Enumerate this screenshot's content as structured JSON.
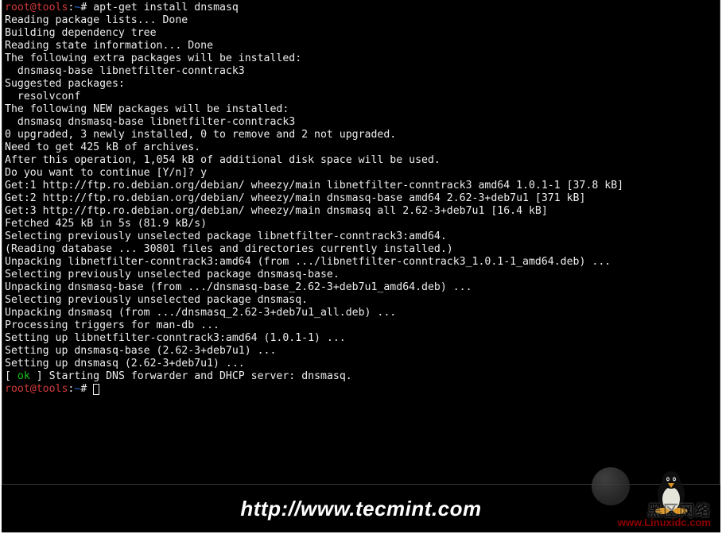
{
  "prompt": {
    "user": "root@tools",
    "sep": ":",
    "path": "~",
    "symbol": "#"
  },
  "command": "apt-get install dnsmasq",
  "lines": [
    "Reading package lists... Done",
    "Building dependency tree",
    "Reading state information... Done",
    "The following extra packages will be installed:",
    "  dnsmasq-base libnetfilter-conntrack3",
    "Suggested packages:",
    "  resolvconf",
    "The following NEW packages will be installed:",
    "  dnsmasq dnsmasq-base libnetfilter-conntrack3",
    "0 upgraded, 3 newly installed, 0 to remove and 2 not upgraded.",
    "Need to get 425 kB of archives.",
    "After this operation, 1,054 kB of additional disk space will be used.",
    "Do you want to continue [Y/n]? y",
    "Get:1 http://ftp.ro.debian.org/debian/ wheezy/main libnetfilter-conntrack3 amd64 1.0.1-1 [37.8 kB]",
    "Get:2 http://ftp.ro.debian.org/debian/ wheezy/main dnsmasq-base amd64 2.62-3+deb7u1 [371 kB]",
    "Get:3 http://ftp.ro.debian.org/debian/ wheezy/main dnsmasq all 2.62-3+deb7u1 [16.4 kB]",
    "Fetched 425 kB in 5s (81.9 kB/s)",
    "Selecting previously unselected package libnetfilter-conntrack3:amd64.",
    "(Reading database ... 30801 files and directories currently installed.)",
    "Unpacking libnetfilter-conntrack3:amd64 (from .../libnetfilter-conntrack3_1.0.1-1_amd64.deb) ...",
    "Selecting previously unselected package dnsmasq-base.",
    "Unpacking dnsmasq-base (from .../dnsmasq-base_2.62-3+deb7u1_amd64.deb) ...",
    "Selecting previously unselected package dnsmasq.",
    "Unpacking dnsmasq (from .../dnsmasq_2.62-3+deb7u1_all.deb) ...",
    "Processing triggers for man-db ...",
    "Setting up libnetfilter-conntrack3:amd64 (1.0.1-1) ...",
    "Setting up dnsmasq-base (2.62-3+deb7u1) ...",
    "Setting up dnsmasq (2.62-3+deb7u1) ..."
  ],
  "status_line": {
    "bracket_open": "[ ",
    "ok": "ok",
    "bracket_close": " ] ",
    "message": "Starting DNS forwarder and DHCP server: dnsmasq."
  },
  "footer_url": "http://www.tecmint.com",
  "watermark": {
    "text1": "黑区网络",
    "sub": "Linux",
    "domain": "www.Linuxidc.com"
  }
}
